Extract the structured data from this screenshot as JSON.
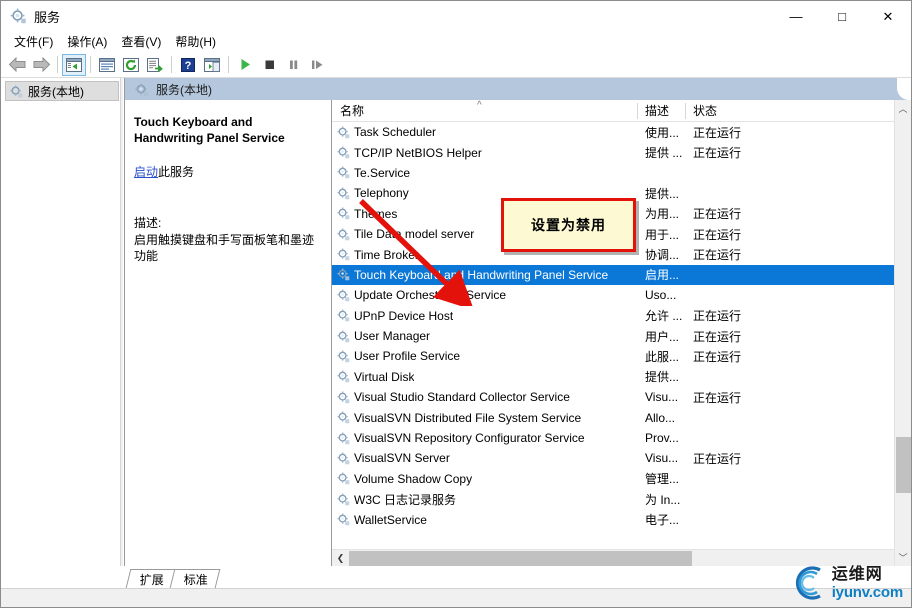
{
  "window": {
    "title": "服务",
    "icon": "services-gear-icon",
    "minimize": "—",
    "maximize": "□",
    "close": "✕"
  },
  "menu": [
    {
      "label": "文件(F)",
      "name": "menu-file"
    },
    {
      "label": "操作(A)",
      "name": "menu-action"
    },
    {
      "label": "查看(V)",
      "name": "menu-view"
    },
    {
      "label": "帮助(H)",
      "name": "menu-help"
    }
  ],
  "toolbar": [
    {
      "name": "back-icon",
      "glyph": "◀"
    },
    {
      "name": "forward-icon",
      "glyph": "▶"
    },
    {
      "name": "show-hide-console-tree-icon",
      "glyph": "▤"
    },
    {
      "name": "properties-icon",
      "glyph": "▣"
    },
    {
      "name": "refresh-icon",
      "glyph": "↻"
    },
    {
      "name": "export-list-icon",
      "glyph": "⇥"
    },
    {
      "name": "help-icon",
      "glyph": "?"
    },
    {
      "name": "show-hide-action-pane-icon",
      "glyph": "▥"
    },
    {
      "name": "start-service-icon",
      "glyph": "▶"
    },
    {
      "name": "stop-service-icon",
      "glyph": "■"
    },
    {
      "name": "pause-service-icon",
      "glyph": "❚❚"
    },
    {
      "name": "restart-service-icon",
      "glyph": "❚▶"
    }
  ],
  "tree": {
    "root_label": "服务(本地)"
  },
  "pane": {
    "header": "服务(本地)"
  },
  "details": {
    "service_name": "Touch Keyboard and Handwriting Panel Service",
    "action_link": "启动",
    "action_suffix": "此服务",
    "description_label": "描述:",
    "description_text": "启用触摸键盘和手写面板笔和墨迹功能"
  },
  "list": {
    "columns": [
      {
        "label": "名称",
        "name": "column-header-name"
      },
      {
        "label": "描述",
        "name": "column-header-description"
      },
      {
        "label": "状态",
        "name": "column-header-status"
      }
    ],
    "sort_indicator": "^",
    "rows": [
      {
        "name": "Task Scheduler",
        "desc": "使用...",
        "state": "正在运行",
        "selected": false
      },
      {
        "name": "TCP/IP NetBIOS Helper",
        "desc": "提供 ...",
        "state": "正在运行",
        "selected": false
      },
      {
        "name": "Te.Service",
        "desc": "",
        "state": "",
        "selected": false
      },
      {
        "name": "Telephony",
        "desc": "提供...",
        "state": "",
        "selected": false
      },
      {
        "name": "Themes",
        "desc": "为用...",
        "state": "正在运行",
        "selected": false
      },
      {
        "name": "Tile Data model server",
        "desc": "用于...",
        "state": "正在运行",
        "selected": false
      },
      {
        "name": "Time Broker",
        "desc": "协调...",
        "state": "正在运行",
        "selected": false
      },
      {
        "name": "Touch Keyboard and Handwriting Panel Service",
        "desc": "启用...",
        "state": "",
        "selected": true
      },
      {
        "name": "Update Orchestrator Service",
        "desc": "Uso...",
        "state": "",
        "selected": false
      },
      {
        "name": "UPnP Device Host",
        "desc": "允许 ...",
        "state": "正在运行",
        "selected": false
      },
      {
        "name": "User Manager",
        "desc": "用户...",
        "state": "正在运行",
        "selected": false
      },
      {
        "name": "User Profile Service",
        "desc": "此服...",
        "state": "正在运行",
        "selected": false
      },
      {
        "name": "Virtual Disk",
        "desc": "提供...",
        "state": "",
        "selected": false
      },
      {
        "name": "Visual Studio Standard Collector Service",
        "desc": "Visu...",
        "state": "正在运行",
        "selected": false
      },
      {
        "name": "VisualSVN Distributed File System Service",
        "desc": "Allo...",
        "state": "",
        "selected": false
      },
      {
        "name": "VisualSVN Repository Configurator Service",
        "desc": "Prov...",
        "state": "",
        "selected": false
      },
      {
        "name": "VisualSVN Server",
        "desc": "Visu...",
        "state": "正在运行",
        "selected": false
      },
      {
        "name": "Volume Shadow Copy",
        "desc": "管理...",
        "state": "",
        "selected": false
      },
      {
        "name": "W3C 日志记录服务",
        "desc": "为 In...",
        "state": "",
        "selected": false
      },
      {
        "name": "WalletService",
        "desc": "电子...",
        "state": "",
        "selected": false
      }
    ]
  },
  "tabs": [
    {
      "label": "扩展",
      "name": "tab-extended",
      "active": false
    },
    {
      "label": "标准",
      "name": "tab-standard",
      "active": true
    }
  ],
  "annotation": {
    "callout_text": "设置为禁用",
    "callout_border_color": "#e3120b",
    "callout_fill_color": "#fdf9d2",
    "arrow_color": "#e3120b"
  },
  "watermark": {
    "cn": "运维网",
    "en": "iyunv.com",
    "accent": "#0f7fc4"
  },
  "colors": {
    "selection": "#0b78d7",
    "pane_header": "#b4c7dd",
    "link": "#2a4fce"
  }
}
